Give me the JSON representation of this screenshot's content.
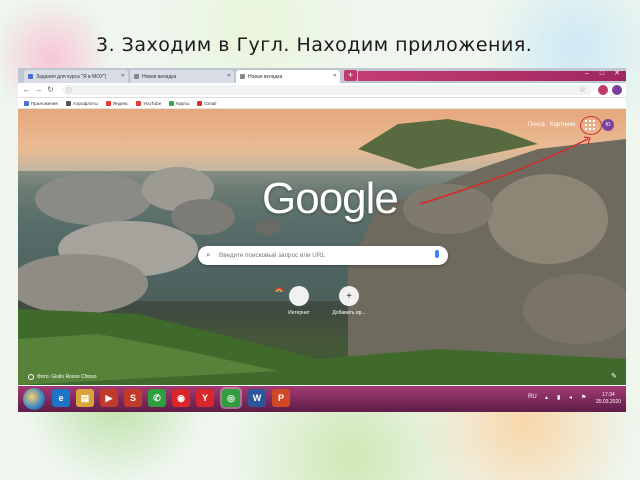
{
  "slide": {
    "title": "3. Заходим в Гугл. Находим приложения."
  },
  "browser": {
    "tabs": [
      {
        "label": "Задания для курса \"Я в МОУ\"(",
        "icon": "doc-icon",
        "active": false
      },
      {
        "label": "Новая вкладка",
        "icon": "page-icon",
        "active": false
      },
      {
        "label": "Новая вкладка",
        "icon": "page-icon",
        "active": true
      }
    ],
    "new_tab": "+",
    "window_controls": {
      "minimize": "–",
      "maximize": "□",
      "close": "✕"
    },
    "omnibox": {
      "value": "",
      "placeholder": ""
    },
    "bookmarks": [
      {
        "label": "Приложения",
        "icon": "apps-icon",
        "color": "#4a6fd1"
      },
      {
        "label": "Аэрофлоты",
        "icon": "plane-icon",
        "color": "#555555"
      },
      {
        "label": "Яндекс",
        "icon": "yandex-icon",
        "color": "#e53935"
      },
      {
        "label": "YouTube",
        "icon": "youtube-icon",
        "color": "#e53935"
      },
      {
        "label": "Карты",
        "icon": "maps-icon",
        "color": "#34a853"
      },
      {
        "label": "Gmail",
        "icon": "gmail-icon",
        "color": "#d93025"
      }
    ]
  },
  "ntp": {
    "links": {
      "mail": "Почта",
      "images": "Картинки"
    },
    "profile_initials": "Ю",
    "logo": "Google",
    "search_placeholder": "Введите поисковый запрос или URL",
    "shortcuts": [
      {
        "label": "Интернет",
        "icon": "rainbow-icon"
      },
      {
        "label": "Добавить яр...",
        "icon": "plus-icon",
        "glyph": "+"
      }
    ],
    "credit": "Фото: Giulio Rosso Chioso"
  },
  "taskbar": {
    "apps": [
      {
        "icon": "ie-icon",
        "glyph": "e",
        "color": "#1e73c8"
      },
      {
        "icon": "explorer-icon",
        "glyph": "▤",
        "color": "#d9a53a"
      },
      {
        "icon": "media-icon",
        "glyph": "▶",
        "color": "#c0392b"
      },
      {
        "icon": "s-icon",
        "glyph": "S",
        "color": "#c0392b"
      },
      {
        "icon": "phone-icon",
        "glyph": "✆",
        "color": "#2e9e3e"
      },
      {
        "icon": "red-app-icon",
        "glyph": "◉",
        "color": "#d9262b"
      },
      {
        "icon": "yandex-browser-icon",
        "glyph": "Y",
        "color": "#d9262b"
      },
      {
        "icon": "chrome-icon",
        "glyph": "◎",
        "color": "#2e9e3e"
      },
      {
        "icon": "word-icon",
        "glyph": "W",
        "color": "#2b579a"
      },
      {
        "icon": "powerpoint-icon",
        "glyph": "P",
        "color": "#d24726"
      }
    ],
    "language": "RU",
    "time": "17:34",
    "date": "25.03.2020"
  }
}
